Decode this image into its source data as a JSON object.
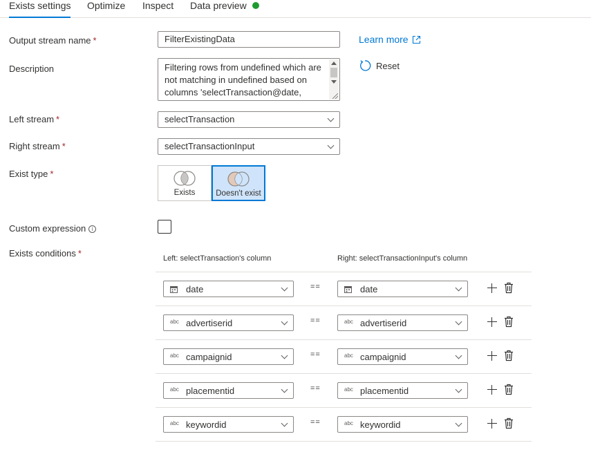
{
  "tabs": [
    {
      "label": "Exists settings"
    },
    {
      "label": "Optimize"
    },
    {
      "label": "Inspect"
    },
    {
      "label": "Data preview"
    }
  ],
  "fields": {
    "output_stream_label": "Output stream name",
    "output_stream_value": "FilterExistingData",
    "description_label": "Description",
    "description_value": "Filtering rows from undefined which are not matching in undefined based on columns 'selectTransaction@date,",
    "left_stream_label": "Left stream",
    "left_stream_value": "selectTransaction",
    "right_stream_label": "Right stream",
    "right_stream_value": "selectTransactionInput",
    "exist_type_label": "Exist type",
    "custom_expression_label": "Custom expression",
    "exists_conditions_label": "Exists conditions",
    "required_mark": "*"
  },
  "links": {
    "learn_more": "Learn more",
    "reset": "Reset"
  },
  "exist_type": {
    "options": [
      {
        "label": "Exists"
      },
      {
        "label": "Doesn't exist"
      }
    ],
    "selected": "Doesn't exist"
  },
  "conditions": {
    "left_header": "Left: selectTransaction's column",
    "right_header": "Right: selectTransactionInput's column",
    "operator": "==",
    "rows": [
      {
        "left_type": "calendar-icon",
        "left": "date",
        "right_type": "calendar-icon",
        "right": "date"
      },
      {
        "left_type": "abc",
        "left": "advertiserid",
        "right_type": "abc",
        "right": "advertiserid"
      },
      {
        "left_type": "abc",
        "left": "campaignid",
        "right_type": "abc",
        "right": "campaignid"
      },
      {
        "left_type": "abc",
        "left": "placementid",
        "right_type": "abc",
        "right": "placementid"
      },
      {
        "left_type": "abc",
        "left": "keywordid",
        "right_type": "abc",
        "right": "keywordid"
      }
    ]
  },
  "colors": {
    "accent": "#0078d4",
    "required": "#a4262c",
    "status_ok": "#1e9b2e",
    "selected_bg": "#cfe4fa"
  }
}
